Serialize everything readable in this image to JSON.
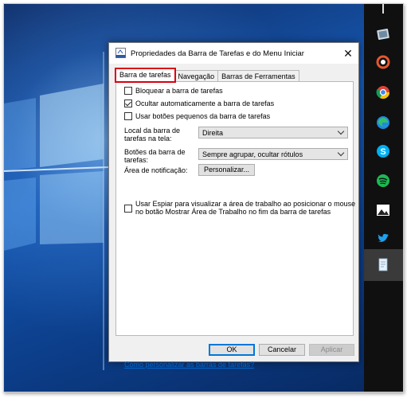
{
  "dialog": {
    "title": "Propriedades da Barra de Tarefas e do Menu Iniciar",
    "close_glyph": "✕",
    "tabs": [
      {
        "label": "Barra de tarefas"
      },
      {
        "label": "Navegação"
      },
      {
        "label": "Barras de Ferramentas"
      }
    ],
    "checkboxes": {
      "lock": {
        "label": "Bloquear a barra de tarefas",
        "checked": false
      },
      "autohide": {
        "label": "Ocultar automaticamente a barra de tarefas",
        "checked": true
      },
      "small_buttons": {
        "label": "Usar botões pequenos da barra de tarefas",
        "checked": false
      },
      "peek": {
        "label_line1": "Usar Espiar para visualizar a área de trabalho ao posicionar o mouse",
        "label_line2": "no botão Mostrar Área de Trabalho no fim da barra de tarefas",
        "checked": false
      }
    },
    "location": {
      "label_line1": "Local da barra de",
      "label_line2": "tarefas na tela:",
      "value": "Direita"
    },
    "buttons_group": {
      "label_line1": "Botões da barra de",
      "label_line2": "tarefas:",
      "value": "Sempre agrupar, ocultar rótulos"
    },
    "notification": {
      "label": "Área de notificação:",
      "button": "Personalizar..."
    },
    "help_link": "Como personalizar as barras de tarefas?",
    "footer": {
      "ok": "OK",
      "cancel": "Cancelar",
      "apply": "Aplicar"
    }
  },
  "taskbar": {
    "icons": [
      "pen-icon",
      "tablet-icon",
      "photo-app-icon",
      "chrome-icon",
      "edge-icon",
      "skype-icon",
      "spotify-icon",
      "photos-icon",
      "twitter-icon",
      "notepad-icon"
    ]
  },
  "colors": {
    "accent": "#0078d7",
    "highlight": "#d9000f",
    "link": "#0066cc"
  }
}
